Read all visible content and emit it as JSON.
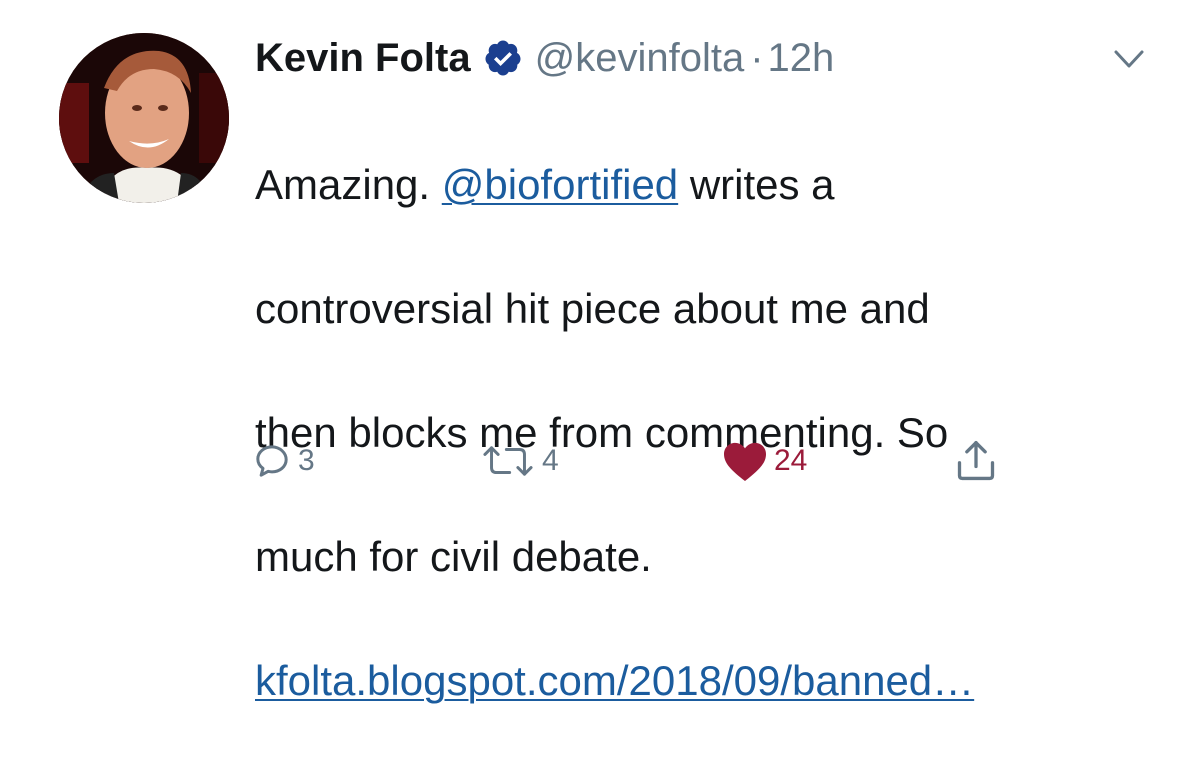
{
  "tweet": {
    "author_name": "Kevin Folta",
    "handle": "@kevinfolta",
    "separator": "·",
    "time": "12h",
    "text_lines": [
      {
        "before": "Amazing. ",
        "mention": "@biofortified",
        "after": " writes a"
      },
      "controversial hit piece about me and",
      "then blocks me from commenting. So",
      "much for civil debate."
    ],
    "link": "kfolta.blogspot.com/2018/09/banned…"
  },
  "actions": {
    "reply_count": "3",
    "retweet_count": "4",
    "like_count": "24"
  },
  "colors": {
    "text": "#14171a",
    "secondary": "#657786",
    "link": "#1b5c9e",
    "verified": "#1b3f8f",
    "like": "#9b1b3a"
  },
  "icons": [
    "verified-badge-icon",
    "chevron-down-icon",
    "reply-icon",
    "retweet-icon",
    "heart-icon",
    "share-icon"
  ]
}
